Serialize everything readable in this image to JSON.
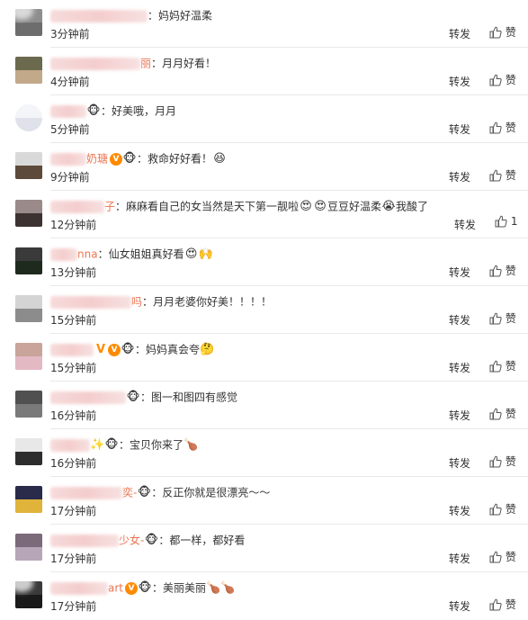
{
  "actions": {
    "forward_label": "转发",
    "like_label": "赞"
  },
  "comments": [
    {
      "name_suffix": "",
      "text": "：妈妈好温柔",
      "time": "3分钟前",
      "like_count": ""
    },
    {
      "name_suffix": "丽",
      "text": "：月月好看！",
      "time": "4分钟前",
      "like_count": ""
    },
    {
      "name_suffix": "",
      "text": "：好美哦，月月",
      "time": "5分钟前",
      "like_count": ""
    },
    {
      "name_suffix": "奶瑭",
      "text": "：救命好好看！",
      "time": "9分钟前",
      "like_count": ""
    },
    {
      "name_suffix": "子",
      "text": "：麻麻看自己的女当然是天下第一靓啦",
      "text2": "豆豆好温柔",
      "text3": "我酸了",
      "time": "12分钟前",
      "like_count": "1"
    },
    {
      "name_suffix": "nna",
      "text": "：仙女姐姐真好看",
      "time": "13分钟前",
      "like_count": ""
    },
    {
      "name_suffix": "吗",
      "text": "：月月老婆你好美！！！！",
      "time": "15分钟前",
      "like_count": ""
    },
    {
      "name_suffix": "",
      "text": "：妈妈真会夸",
      "time": "15分钟前",
      "like_count": ""
    },
    {
      "name_suffix": "",
      "text": "：图一和图四有感觉",
      "time": "16分钟前",
      "like_count": ""
    },
    {
      "name_suffix": "",
      "text": "：宝贝你来了",
      "time": "16分钟前",
      "like_count": ""
    },
    {
      "name_suffix": "奕-",
      "text": "：反正你就是很漂亮～～",
      "time": "17分钟前",
      "like_count": ""
    },
    {
      "name_suffix": "少女-",
      "text": "：都一样，都好看",
      "time": "17分钟前",
      "like_count": ""
    },
    {
      "name_suffix": "art",
      "text": "：美丽美丽",
      "time": "17分钟前",
      "like_count": ""
    }
  ],
  "colors": {
    "name": "#eb7350",
    "text": "#333333",
    "divider": "#e9e9e9"
  }
}
